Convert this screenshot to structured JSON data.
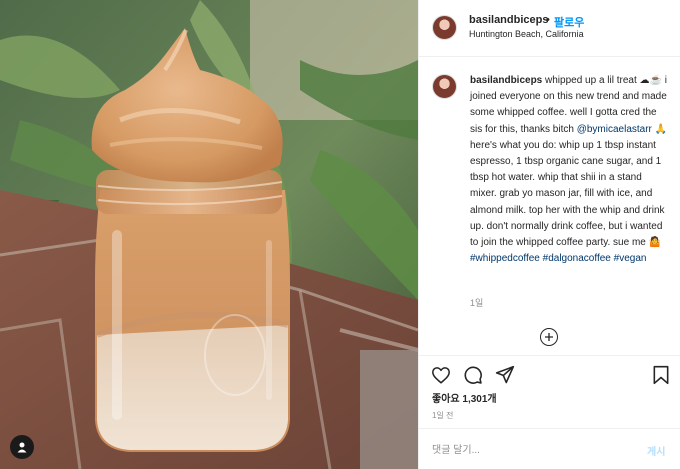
{
  "post": {
    "username": "basilandbiceps",
    "follow_label": "팔로우",
    "dot": "•",
    "location": "Huntington Beach, California"
  },
  "caption": {
    "username": "basilandbiceps",
    "text_1": " whipped up a lil treat ",
    "emoji_1": "☁☕",
    "text_2": " i joined everyone on this new trend and made some whipped coffee. well I gotta cred the sis for this, thanks bitch ",
    "mention": "@bymicaelastarr",
    "emoji_2": " 🙏",
    "text_3": " here's what you do: whip up 1 tbsp instant espresso, 1 tbsp organic cane sugar, and 1 tbsp hot water. whip that shii in a stand mixer. grab yo mason jar, fill with ice, and almond milk. top her with the whip and drink up. don't normally drink coffee, but i wanted to join the whipped coffee party. sue me ",
    "emoji_3": "🤷",
    "hashtags": " #whippedcoffee #dalgonacoffee #vegan",
    "time_ago": "1일"
  },
  "actions": {
    "likes": "좋아요 1,301개",
    "date": "1일 전"
  },
  "comment": {
    "placeholder": "댓글 달기...",
    "post_label": "게시"
  },
  "icons": {
    "heart": "heart-icon",
    "comment": "comment-icon",
    "share": "share-icon",
    "save": "bookmark-icon",
    "load_more": "plus-circle-icon",
    "user_tag": "user-tag-icon"
  }
}
